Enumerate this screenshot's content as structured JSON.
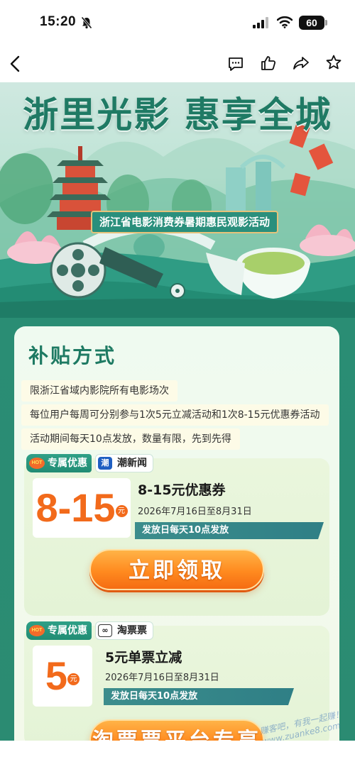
{
  "status_bar": {
    "time": "15:20",
    "battery": "60"
  },
  "nav": {
    "icons": [
      "back-icon",
      "comment-icon",
      "like-icon",
      "share-icon",
      "star-icon"
    ]
  },
  "hero": {
    "title": "浙里光影 惠享全城",
    "subtitle": "浙江省电影消费券暑期惠民观影活动"
  },
  "subsidy": {
    "title": "补贴方式",
    "rules": [
      "限浙江省域内影院所有电影场次",
      "每位用户每周可分别参与1次5元立减活动和1次8-15元优惠券活动",
      "活动期间每天10点发放，数量有限，先到先得"
    ]
  },
  "offers": [
    {
      "tag": "专属优惠",
      "hot_badge": "HOT",
      "source": "潮新闻",
      "source_logo": "潮",
      "amount": "8-15",
      "unit": "元",
      "name": "8-15元优惠券",
      "date": "2026年7月16日至8月31日",
      "note": "发放日每天10点发放",
      "button": "立即领取"
    },
    {
      "tag": "专属优惠",
      "hot_badge": "HOT",
      "source": "淘票票",
      "source_logo": "∞",
      "amount": "5",
      "unit": "元",
      "name": "5元单票立减",
      "date": "2026年7月16日至8月31日",
      "note": "发放日每天10点发放",
      "button": "淘票票平台专享"
    }
  ],
  "watermark": "赚客吧，有我一起赚！ www.zuanke8.com",
  "colors": {
    "primary_green": "#2a8d74",
    "accent_orange": "#f26a1b",
    "button_orange": "#ff8a1f"
  }
}
